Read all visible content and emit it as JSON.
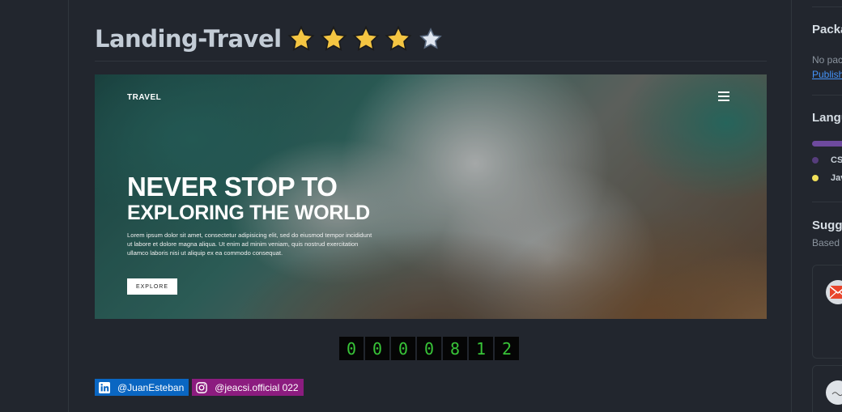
{
  "repo": {
    "title": "Landing-Travel",
    "rating": 4,
    "rating_max": 5
  },
  "hero": {
    "logo": "TRAVEL",
    "headline_1": "NEVER STOP TO",
    "headline_2": "EXPLORING THE WORLD",
    "paragraph": "Lorem ipsum dolor sit amet, consectetur adipisicing elit, sed do eiusmod tempor incididunt ut labore et dolore magna aliqua. Ut enim ad minim veniam, quis nostrud exercitation ullamco laboris nisi ut aliquip ex ea commodo consequat.",
    "button_label": "EXPLORE"
  },
  "counter": {
    "digits": [
      "0",
      "0",
      "0",
      "0",
      "8",
      "1",
      "2"
    ]
  },
  "badges": {
    "linkedin": "@JuanEsteban",
    "instagram": "@jeacsi.official 022"
  },
  "sidebar": {
    "packages_heading": "Packa",
    "packages_text": "No pac",
    "packages_link": "Publish",
    "languages_heading": "Langu",
    "languages": [
      {
        "name": "CS",
        "color": "#563d7c"
      },
      {
        "name": "Jav",
        "color": "#f1e05a"
      }
    ],
    "suggested_heading": "Sugg",
    "suggested_sub": "Based"
  },
  "colors": {
    "star": "#f4c542",
    "counter_text": "#38c438",
    "linkedin": "#0a66c2",
    "instagram": "#8c1c7f"
  }
}
